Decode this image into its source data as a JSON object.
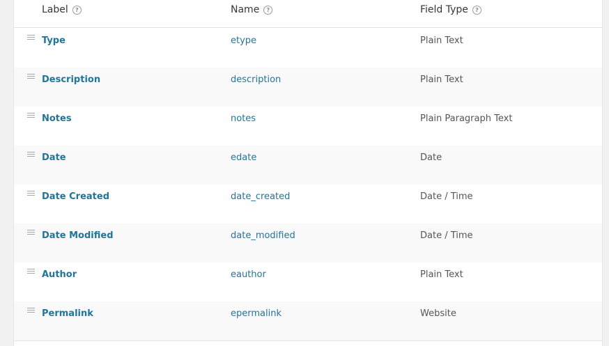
{
  "header": {
    "label": "Label",
    "name": "Name",
    "field_type": "Field Type",
    "help_glyph": "?"
  },
  "rows": [
    {
      "label": "Type",
      "name": "etype",
      "field_type": "Plain Text"
    },
    {
      "label": "Description",
      "name": "description",
      "field_type": "Plain Text"
    },
    {
      "label": "Notes",
      "name": "notes",
      "field_type": "Plain Paragraph Text"
    },
    {
      "label": "Date",
      "name": "edate",
      "field_type": "Date"
    },
    {
      "label": "Date Created",
      "name": "date_created",
      "field_type": "Date / Time"
    },
    {
      "label": "Date Modified",
      "name": "date_modified",
      "field_type": "Date / Time"
    },
    {
      "label": "Author",
      "name": "eauthor",
      "field_type": "Plain Text"
    },
    {
      "label": "Permalink",
      "name": "epermalink",
      "field_type": "Website"
    }
  ],
  "colors": {
    "link": "#21759b",
    "alt_row": "#f9f9f9",
    "page_bg": "#f1f1f1"
  }
}
